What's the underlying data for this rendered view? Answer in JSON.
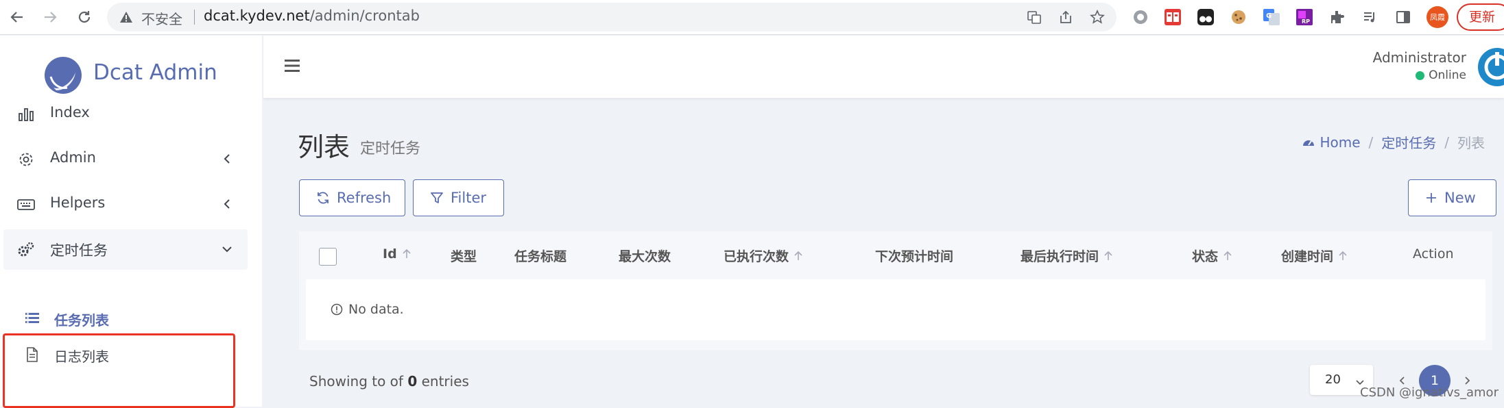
{
  "browser": {
    "insecure_label": "不安全",
    "url_host": "dcat.kydev.net",
    "url_path": "/admin/crontab",
    "update_label": "更新",
    "profile_label": "凤霞"
  },
  "sidebar": {
    "brand": "Dcat Admin",
    "items": [
      {
        "label": "Index"
      },
      {
        "label": "Admin"
      },
      {
        "label": "Helpers"
      },
      {
        "label": "定时任务"
      }
    ],
    "subitems": [
      {
        "label": "任务列表"
      },
      {
        "label": "日志列表"
      }
    ]
  },
  "navbar": {
    "user_name": "Administrator",
    "user_status": "Online"
  },
  "page": {
    "title": "列表",
    "subtitle": "定时任务",
    "breadcrumb": {
      "home": "Home",
      "section": "定时任务",
      "current": "列表",
      "separator": "/"
    }
  },
  "toolbar": {
    "refresh_label": "Refresh",
    "filter_label": "Filter",
    "new_label": "New"
  },
  "table": {
    "columns": [
      {
        "label": "Id",
        "sortable": true
      },
      {
        "label": "类型",
        "sortable": false
      },
      {
        "label": "任务标题",
        "sortable": false
      },
      {
        "label": "最大次数",
        "sortable": false
      },
      {
        "label": "已执行次数",
        "sortable": true
      },
      {
        "label": "下次预计时间",
        "sortable": false
      },
      {
        "label": "最后执行时间",
        "sortable": true
      },
      {
        "label": "状态",
        "sortable": true
      },
      {
        "label": "创建时间",
        "sortable": true
      },
      {
        "label": "Action",
        "sortable": false
      }
    ],
    "empty_text": "No data."
  },
  "pagination": {
    "entries_prefix": "Showing to of",
    "entries_total": "0",
    "entries_suffix": "entries",
    "per_page": "20",
    "current_page": "1"
  },
  "watermark": "CSDN @ignativs_amor",
  "colors": {
    "primary": "#586cb1",
    "online": "#21b978",
    "highlight_box": "#ea3323"
  }
}
